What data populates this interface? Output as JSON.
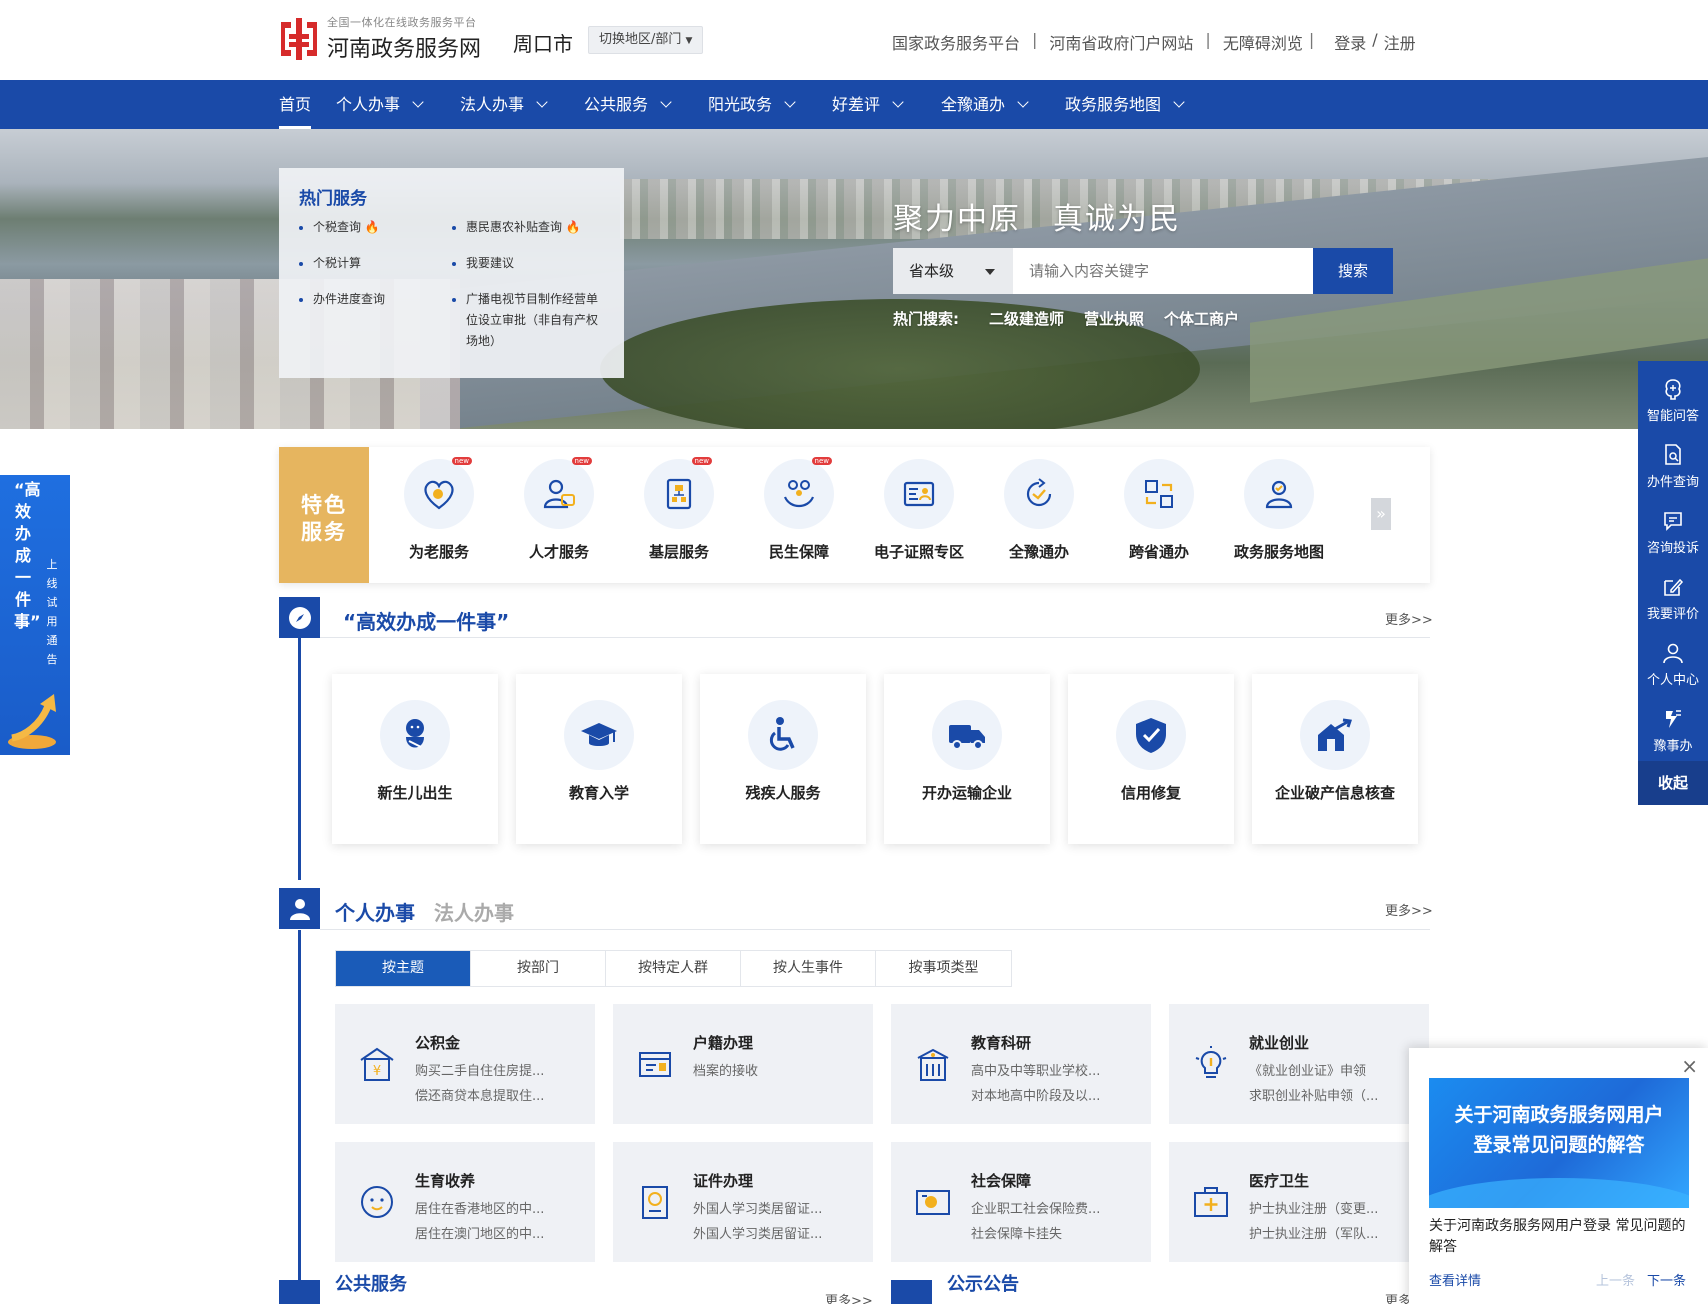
{
  "header": {
    "logo_sub": "全国一体化在线政务服务平台",
    "logo_main": "河南政务服务网",
    "city": "周口市",
    "switch_label": "切换地区/部门",
    "links": [
      "国家政务服务平台",
      "河南省政府门户网站",
      "无障碍浏览"
    ],
    "login": "登录",
    "register": "注册"
  },
  "nav": {
    "items": [
      "首页",
      "个人办事",
      "法人办事",
      "公共服务",
      "阳光政务",
      "好差评",
      "全豫通办",
      "政务服务地图"
    ]
  },
  "hot": {
    "title": "热门服务",
    "items": [
      "个税查询",
      "惠民惠农补贴查询",
      "个税计算",
      "我要建议",
      "办件进度查询",
      "广播电视节目制作经营单位设立审批（非自有产权场地）"
    ]
  },
  "banner": {
    "slogan": "聚力中原　真诚为民",
    "scope": "省本级",
    "placeholder": "请输入内容关键字",
    "search_btn": "搜索",
    "hot_label": "热门搜索:",
    "hot_terms": [
      "二级建造师",
      "营业执照",
      "个体工商户"
    ]
  },
  "feature": {
    "label_line1": "特色",
    "label_line2": "服务",
    "new_tag": "new",
    "items": [
      "为老服务",
      "人才服务",
      "基层服务",
      "民生保障",
      "电子证照专区",
      "全豫通办",
      "跨省通办",
      "政务服务地图"
    ]
  },
  "efficient": {
    "title": "“高效办成一件事”",
    "more": "更多>>",
    "items": [
      "新生儿出生",
      "教育入学",
      "残疾人服务",
      "开办运输企业",
      "信用修复",
      "企业破产信息核查"
    ]
  },
  "personal": {
    "title_active": "个人办事",
    "title_inactive": "法人办事",
    "more": "更多>>",
    "tabs": [
      "按主题",
      "按部门",
      "按特定人群",
      "按人生事件",
      "按事项类型"
    ],
    "topics": [
      {
        "title": "公积金",
        "l1": "购买二手自住住房提...",
        "l2": "偿还商贷本息提取住..."
      },
      {
        "title": "户籍办理",
        "l1": "档案的接收",
        "l2": ""
      },
      {
        "title": "教育科研",
        "l1": "高中及中等职业学校...",
        "l2": "对本地高中阶段及以..."
      },
      {
        "title": "就业创业",
        "l1": "《就业创业证》申领",
        "l2": "求职创业补贴申领（..."
      },
      {
        "title": "生育收养",
        "l1": "居住在香港地区的中...",
        "l2": "居住在澳门地区的中..."
      },
      {
        "title": "证件办理",
        "l1": "外国人学习类居留证...",
        "l2": "外国人学习类居留证..."
      },
      {
        "title": "社会保障",
        "l1": "企业职工社会保险费...",
        "l2": "社会保障卡挂失"
      },
      {
        "title": "医疗卫生",
        "l1": "护士执业注册（变更...",
        "l2": "护士执业注册（军队..."
      }
    ]
  },
  "bottom": {
    "public": "公共服务",
    "public_more": "更多>>",
    "notice": "公示公告",
    "notice_more": "更多"
  },
  "left_float": {
    "big": "“高效办成一件事”",
    "small": "上线试用通告"
  },
  "right_float": {
    "items": [
      "智能问答",
      "办件查询",
      "咨询投诉",
      "我要评价",
      "个人中心",
      "豫事办"
    ],
    "collapse": "收起"
  },
  "popup": {
    "banner": "关于河南政务服务网用户登录常见问题的解答",
    "text": "关于河南政务服务网用户登录 常见问题的解答",
    "detail": "查看详情",
    "prev": "上一条",
    "next": "下一条",
    "close": "×"
  },
  "colors": {
    "primary": "#1a4aa8",
    "feature_gold": "#e6b55f",
    "tab_active": "#1a5bb8"
  }
}
